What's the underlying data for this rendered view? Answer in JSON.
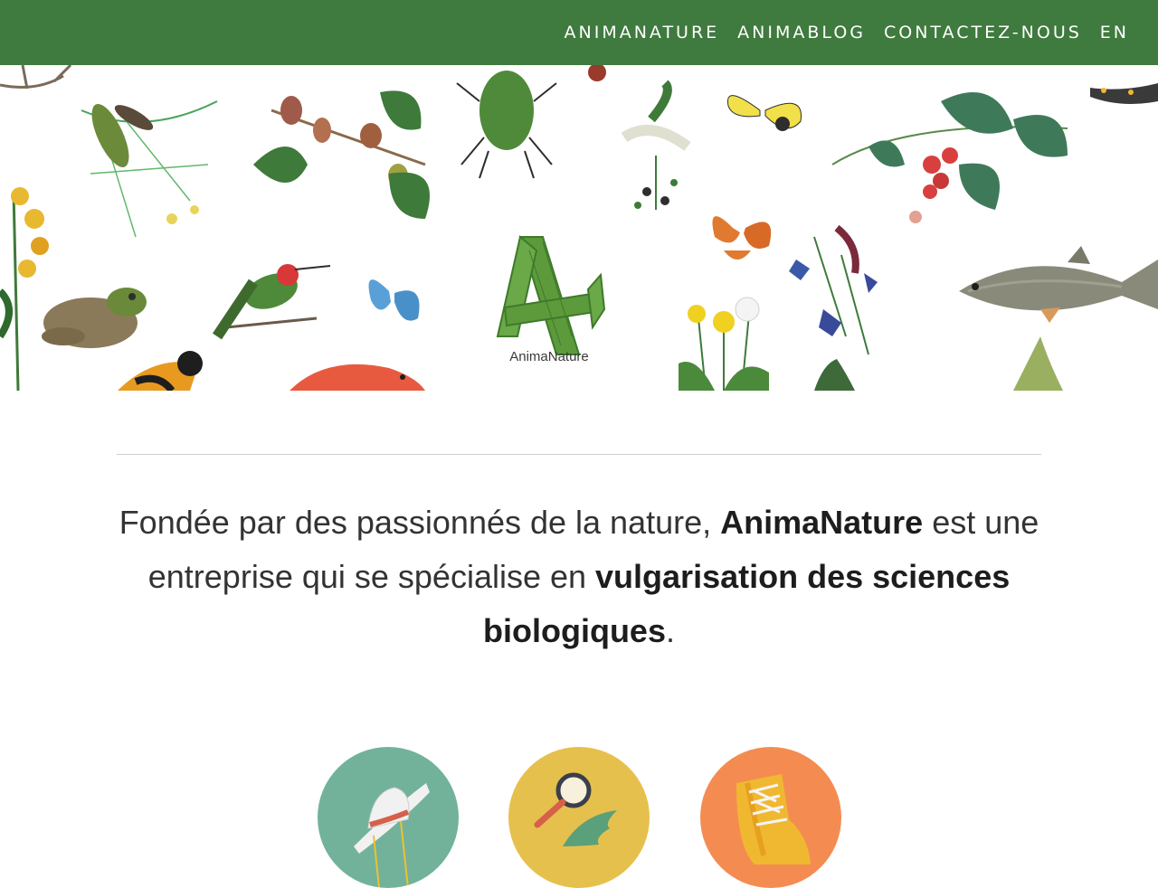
{
  "nav": {
    "items": [
      {
        "label": "ANIMANATURE"
      },
      {
        "label": "ANIMABLOG"
      },
      {
        "label": "CONTACTEZ-NOUS"
      },
      {
        "label": "EN"
      }
    ]
  },
  "hero": {
    "logo_text": "AnimaNature"
  },
  "intro": {
    "part1": "Fondée par des passionnés de la nature, ",
    "brand": "AnimaNature",
    "part2": " est une entreprise qui se spécialise en ",
    "focus": "vulgarisation des sciences biologiques",
    "part3": "."
  },
  "features": [
    {
      "icon": "explorer-hat-icon",
      "color": "#72b29a"
    },
    {
      "icon": "magnifier-leaf-icon",
      "color": "#e6c04d"
    },
    {
      "icon": "hiking-boot-icon",
      "color": "#f48c52"
    }
  ],
  "colors": {
    "header": "#3f7a3e",
    "logo_green": "#5c9a3c"
  }
}
